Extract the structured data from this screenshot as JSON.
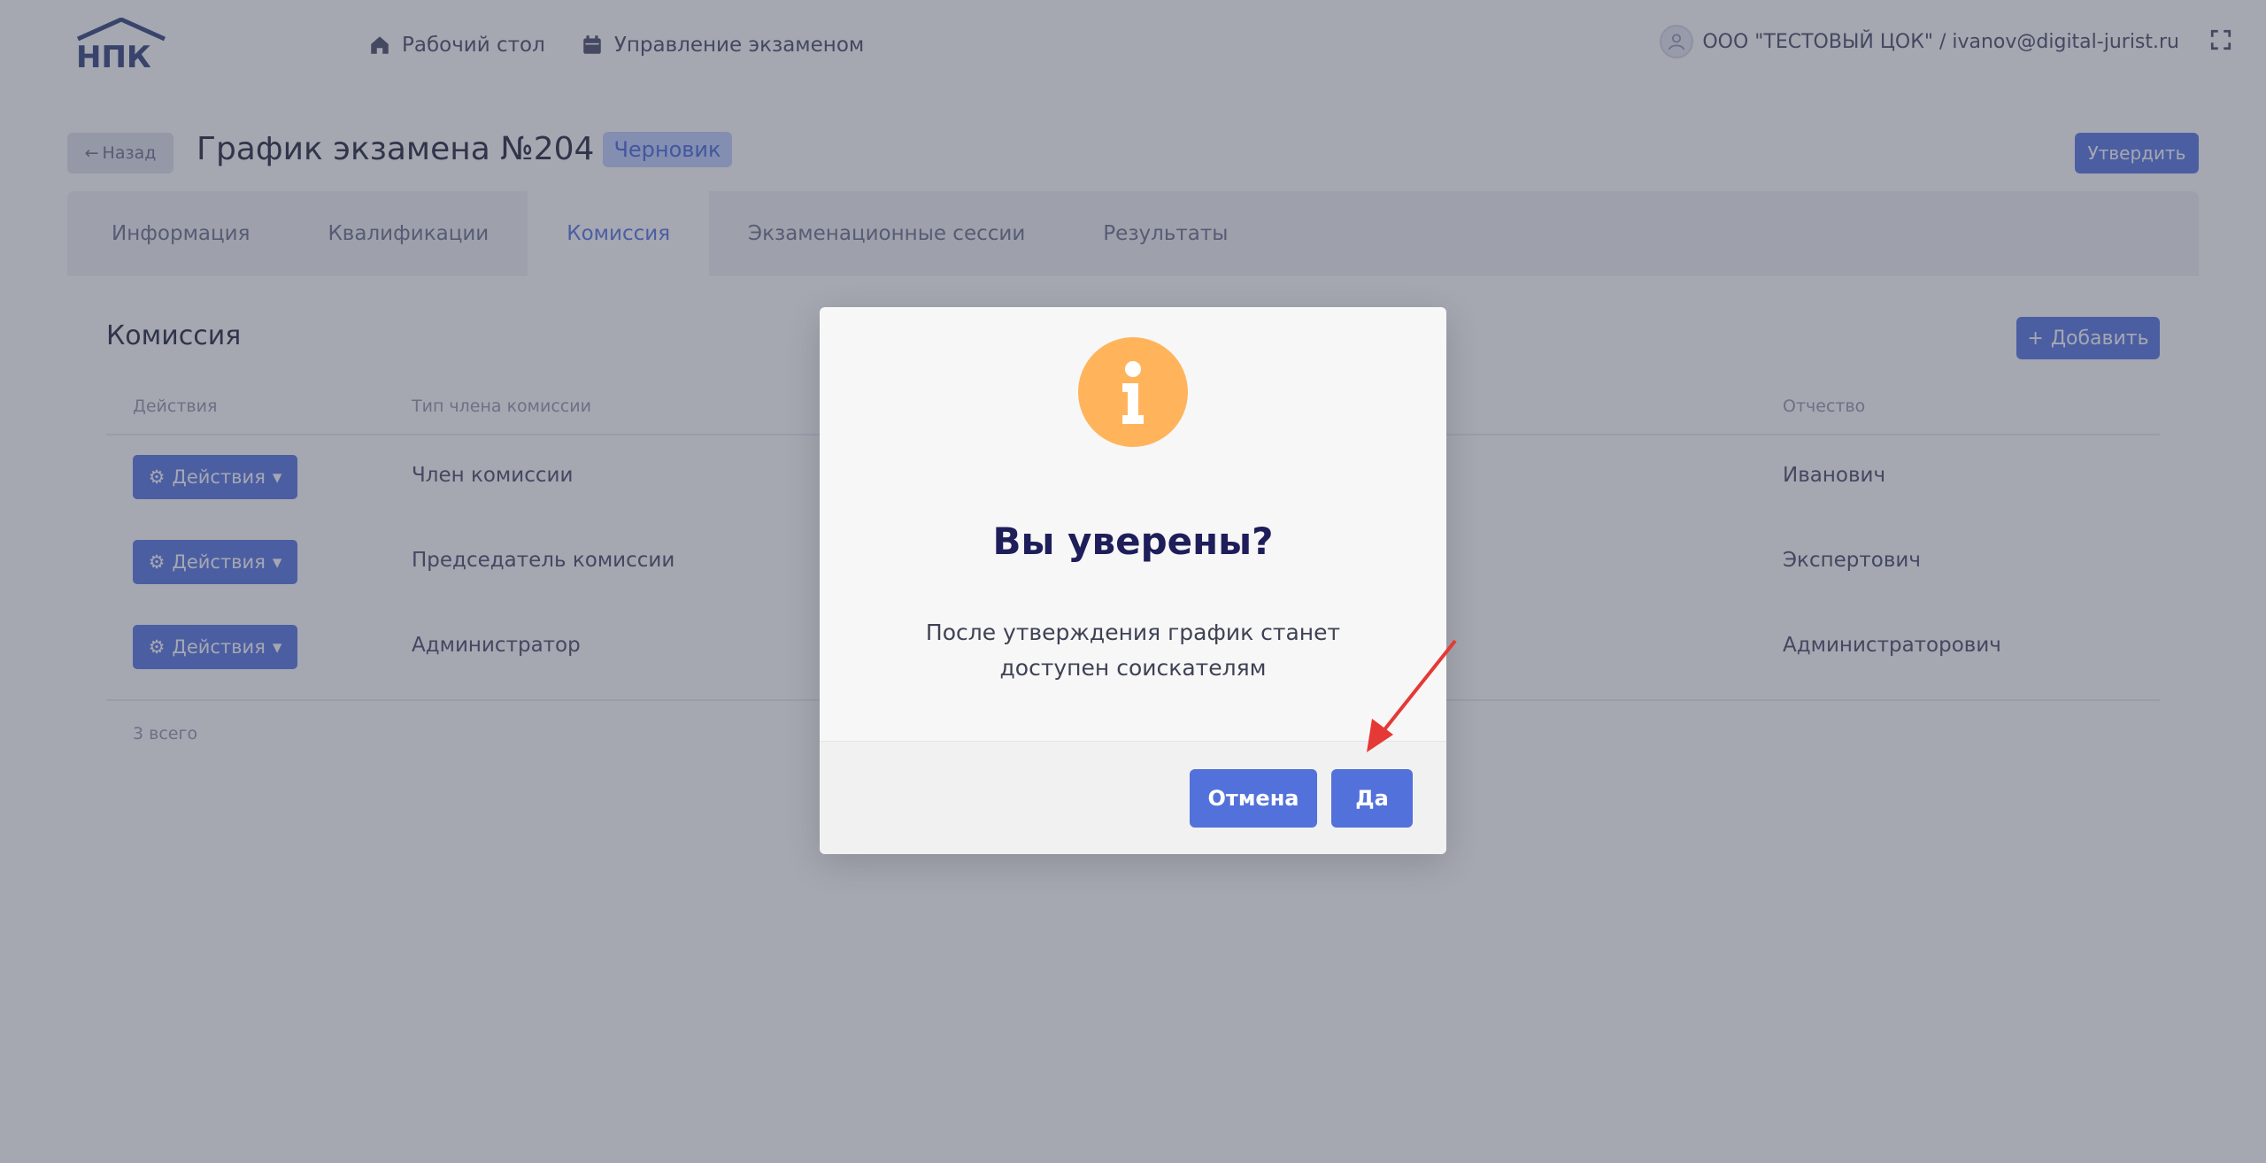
{
  "navbar": {
    "logo_text": "НПК",
    "items": [
      {
        "label": "Рабочий стол",
        "icon": "home-icon"
      },
      {
        "label": "Управление экзаменом",
        "icon": "calendar-icon"
      }
    ],
    "user_label": "ООО \"ТЕСТОВЫЙ ЦОК\" / ivanov@digital-jurist.ru"
  },
  "header": {
    "back_label": "Назад",
    "title": "График экзамена №204",
    "status": "Черновик",
    "approve_label": "Утвердить"
  },
  "tabs": [
    {
      "label": "Информация",
      "active": false
    },
    {
      "label": "Квалификации",
      "active": false
    },
    {
      "label": "Комиссия",
      "active": true
    },
    {
      "label": "Экзаменационные сессии",
      "active": false
    },
    {
      "label": "Результаты",
      "active": false
    }
  ],
  "commission": {
    "title": "Комиссия",
    "add_label": "Добавить",
    "columns": {
      "actions": "Действия",
      "type": "Тип члена комиссии",
      "patronymic": "Отчество"
    },
    "rows": [
      {
        "actions_label": "Действия",
        "type": "Член комиссии",
        "patronymic": "Иванович"
      },
      {
        "actions_label": "Действия",
        "type": "Председатель комиссии",
        "patronymic": "Экспертович"
      },
      {
        "actions_label": "Действия",
        "type": "Администратор",
        "patronymic": "Администраторович"
      }
    ],
    "total": "3 всего"
  },
  "modal": {
    "title": "Вы уверены?",
    "text": "После утверждения график станет доступен соискателям",
    "cancel_label": "Отмена",
    "confirm_label": "Да"
  },
  "colors": {
    "primary": "#5271db",
    "warning": "#ffb45c",
    "arrow": "#e53935"
  }
}
